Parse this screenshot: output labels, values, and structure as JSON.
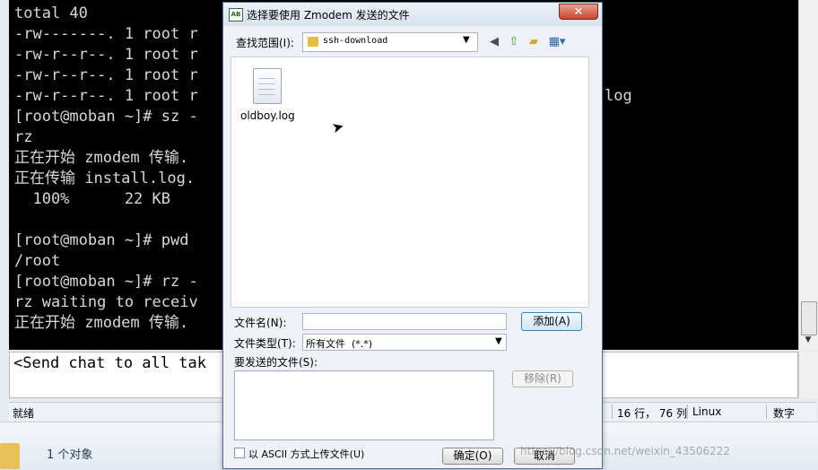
{
  "terminal": {
    "lines": [
      "total 40",
      "-rw-------. 1 root r",
      "-rw-r--r--. 1 root r",
      "-rw-r--r--. 1 root r",
      "-rw-r--r--. 1 root r",
      "[root@moban ~]# sz -",
      "rz",
      "正在开始 zmodem 传输.",
      "正在传输 install.log.",
      "  100%      22 KB",
      "",
      "[root@moban ~]# pwd",
      "/root",
      "[root@moban ~]# rz -",
      "rz waiting to receiv",
      "正在开始 zmodem 传输."
    ],
    "right_fragment": "log",
    "chat_text": "<Send chat to all tak"
  },
  "status_bar": {
    "left": "就绪",
    "position": "16 行， 76 列",
    "os": "Linux",
    "mode": "数字"
  },
  "explorer": {
    "objects": "1 个对象"
  },
  "dialog": {
    "title": "选择要使用 Zmodem 发送的文件",
    "app_icon_text": "AB",
    "close_glyph": "✕",
    "look_in_label": "查找范围(I):",
    "look_in_value": "ssh-download",
    "files": [
      {
        "name": "oldboy.log",
        "icon": "document-icon"
      }
    ],
    "filename_label": "文件名(N):",
    "filename_value": "",
    "filetype_label": "文件类型(T):",
    "filetype_value": "所有文件  (*.*)",
    "send_list_label": "要发送的文件(S):",
    "add_button": "添加(A)",
    "remove_button": "移除(R)",
    "ascii_label": "以 ASCII 方式上传文件(U)",
    "ok_button": "确定(O)",
    "cancel_button": "取消"
  },
  "watermark": "https://blog.csdn.net/weixin_43506222",
  "icons": {
    "back": "back-icon",
    "up": "up-folder-icon",
    "new_folder": "new-folder-icon",
    "views": "views-menu-icon"
  },
  "colors": {
    "terminal_bg": "#000000",
    "terminal_fg": "#d8d8d8",
    "dialog_bg": "#eef2f7",
    "close_red": "#c8452e",
    "default_button_border": "#3c7fb1"
  }
}
